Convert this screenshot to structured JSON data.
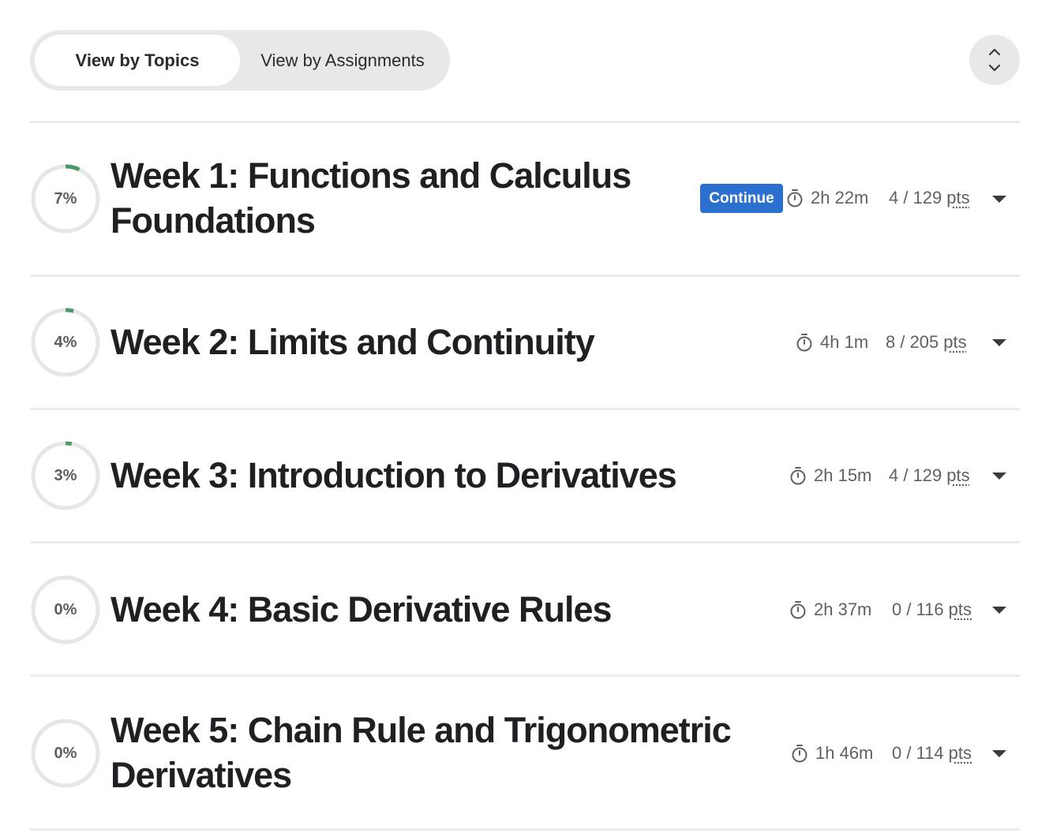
{
  "view_toggle": {
    "topics_label": "View by Topics",
    "assignments_label": "View by Assignments"
  },
  "colors": {
    "accent": "#2b70cf",
    "progress": "#4a9b66",
    "ring_track": "#e6e6e6"
  },
  "weeks": [
    {
      "progress_label": "7%",
      "progress": 0.07,
      "title_line1": "Week 1: Functions and Calculus",
      "title_line2": "Foundations",
      "continue_label": "Continue",
      "duration": "2h 22m",
      "points": "4 / 129",
      "pts_label": "pts"
    },
    {
      "progress_label": "4%",
      "progress": 0.04,
      "title_line1": "Week 2: Limits and Continuity",
      "duration": "4h 1m",
      "points": "8 / 205",
      "pts_label": "pts"
    },
    {
      "progress_label": "3%",
      "progress": 0.03,
      "title_line1": "Week 3: Introduction to Derivatives",
      "duration": "2h 15m",
      "points": "4 / 129",
      "pts_label": "pts"
    },
    {
      "progress_label": "0%",
      "progress": 0.0,
      "title_line1": "Week 4: Basic Derivative Rules",
      "duration": "2h 37m",
      "points": "0 / 116",
      "pts_label": "pts"
    },
    {
      "progress_label": "0%",
      "progress": 0.0,
      "title_line1": "Week 5: Chain Rule and Trigonometric",
      "title_line2": "Derivatives",
      "duration": "1h 46m",
      "points": "0 / 114",
      "pts_label": "pts"
    }
  ]
}
